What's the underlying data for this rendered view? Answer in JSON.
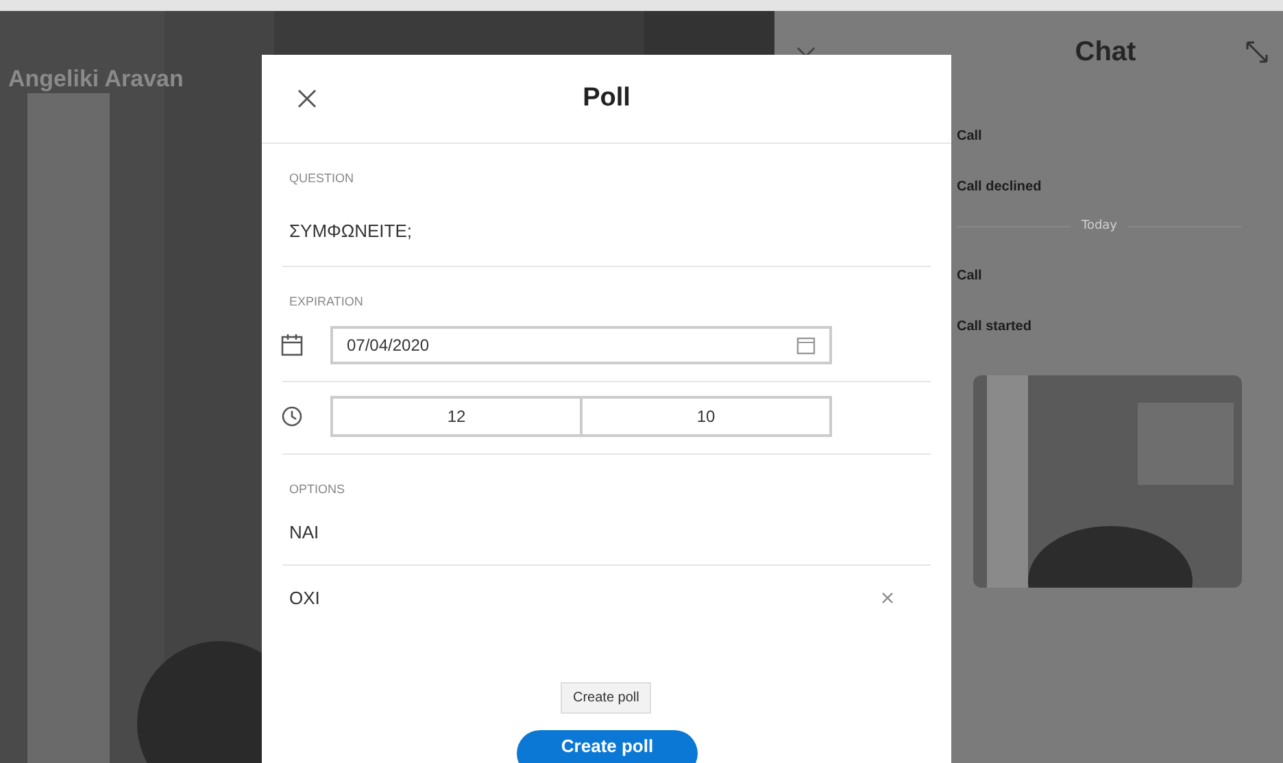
{
  "video": {
    "caller_name": "Angeliki Aravan"
  },
  "chat": {
    "title": "Chat",
    "items": [
      {
        "kind": "event",
        "text": "Call"
      },
      {
        "kind": "event",
        "text": "Call declined"
      },
      {
        "kind": "day",
        "text": "Today"
      },
      {
        "kind": "event",
        "text": "Call"
      },
      {
        "kind": "event",
        "text": "Call started"
      },
      {
        "kind": "picture"
      }
    ]
  },
  "poll": {
    "title": "Poll",
    "question": {
      "label": "QUESTION",
      "value": "ΣΥΜΦΩΝΕΙΤΕ;"
    },
    "expiration": {
      "label": "EXPIRATION",
      "date": "07/04/2020",
      "hour": "12",
      "minute": "10"
    },
    "options": {
      "label": "OPTIONS",
      "items": [
        {
          "text": "NAI",
          "removable": false
        },
        {
          "text": "OXI",
          "removable": true
        }
      ]
    },
    "tooltip": "Create poll",
    "submit": "Create poll"
  }
}
